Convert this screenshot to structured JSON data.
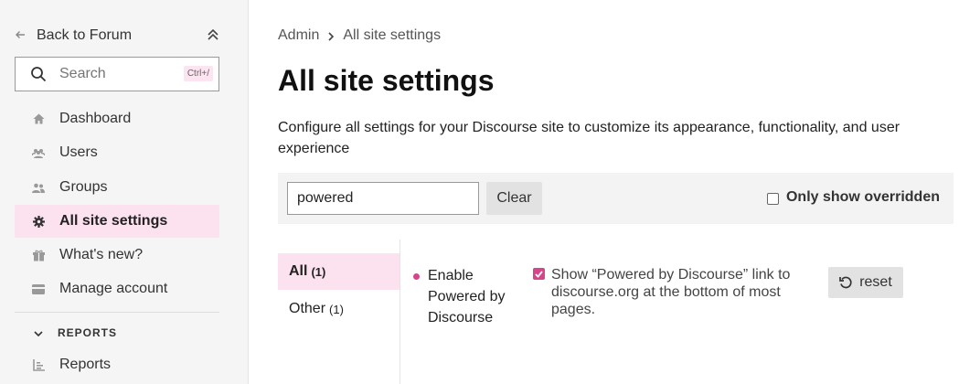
{
  "sidebar": {
    "back_label": "Back to Forum",
    "search": {
      "placeholder": "Search",
      "shortcut": "Ctrl+/"
    },
    "items": [
      {
        "label": "Dashboard",
        "icon": "home-icon"
      },
      {
        "label": "Users",
        "icon": "users-icon"
      },
      {
        "label": "Groups",
        "icon": "groups-icon"
      },
      {
        "label": "All site settings",
        "icon": "gear-icon",
        "active": true
      },
      {
        "label": "What's new?",
        "icon": "gift-icon"
      },
      {
        "label": "Manage account",
        "icon": "credit-card-icon"
      }
    ],
    "reports_section": {
      "label": "REPORTS",
      "items": [
        {
          "label": "Reports",
          "icon": "chart-icon"
        }
      ]
    }
  },
  "breadcrumb": {
    "root": "Admin",
    "current": "All site settings"
  },
  "page": {
    "title": "All site settings",
    "description": "Configure all settings for your Discourse site to customize its appearance, functionality, and user experience"
  },
  "filter": {
    "value": "powered",
    "clear_label": "Clear",
    "override_label": "Only show overridden",
    "override_checked": false
  },
  "categories": [
    {
      "label": "All",
      "count": "(1)",
      "active": true
    },
    {
      "label": "Other",
      "count": "(1)"
    }
  ],
  "setting": {
    "name": "Enable Powered by Discourse",
    "description": "Show “Powered by Discourse” link to discourse.org at the bottom of most pages.",
    "checked": true,
    "reset_label": "reset"
  },
  "colors": {
    "accent": "#d6448b",
    "active_bg": "#fce1ef",
    "sidebar_bg": "#f5f5f5"
  }
}
